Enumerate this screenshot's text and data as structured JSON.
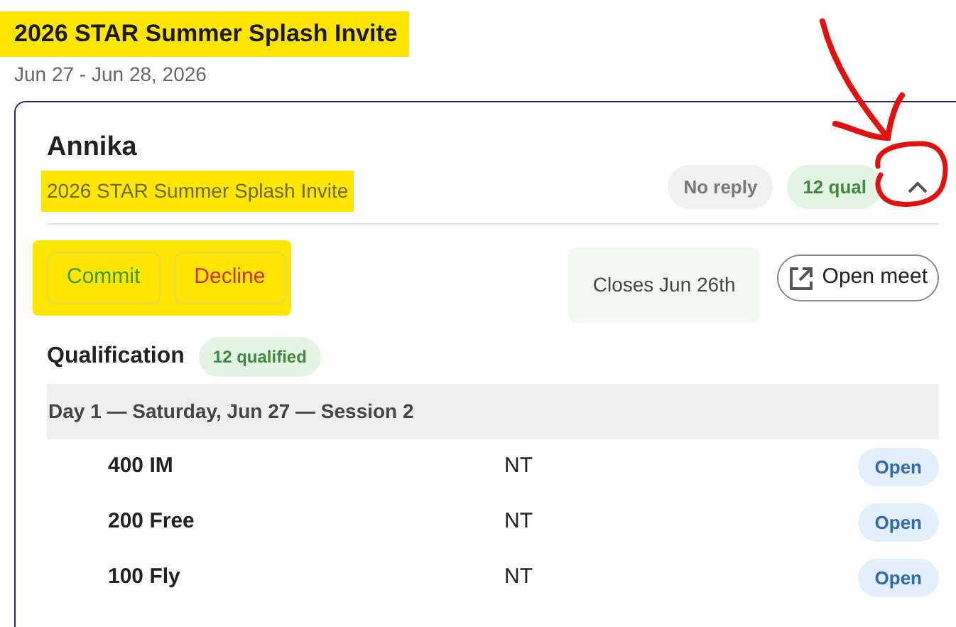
{
  "meet": {
    "title": "2026 STAR Summer Splash Invite",
    "dates": "Jun 27 - Jun 28, 2026"
  },
  "card": {
    "swimmer": "Annika",
    "meet_name": "2026 STAR Summer Splash Invite",
    "badges": [
      {
        "label": "No reply",
        "kind": "neutral"
      },
      {
        "label": "12 qual",
        "kind": "success"
      }
    ],
    "expanded": true,
    "actions": [
      {
        "label": "Commit",
        "kind": "commit"
      },
      {
        "label": "Decline",
        "kind": "decline"
      }
    ],
    "closes": "Closes Jun 26th",
    "open_meet": "Open meet",
    "qualification": {
      "label": "Qualification",
      "count": "12 qualified"
    },
    "sessions": [
      {
        "label": "Day 1 — Saturday, Jun 27 — Session 2",
        "events": [
          {
            "name": "400 IM",
            "time": "NT",
            "status": "Open"
          },
          {
            "name": "200 Free",
            "time": "NT",
            "status": "Open"
          },
          {
            "name": "100 Fly",
            "time": "NT",
            "status": "Open"
          }
        ]
      }
    ]
  }
}
